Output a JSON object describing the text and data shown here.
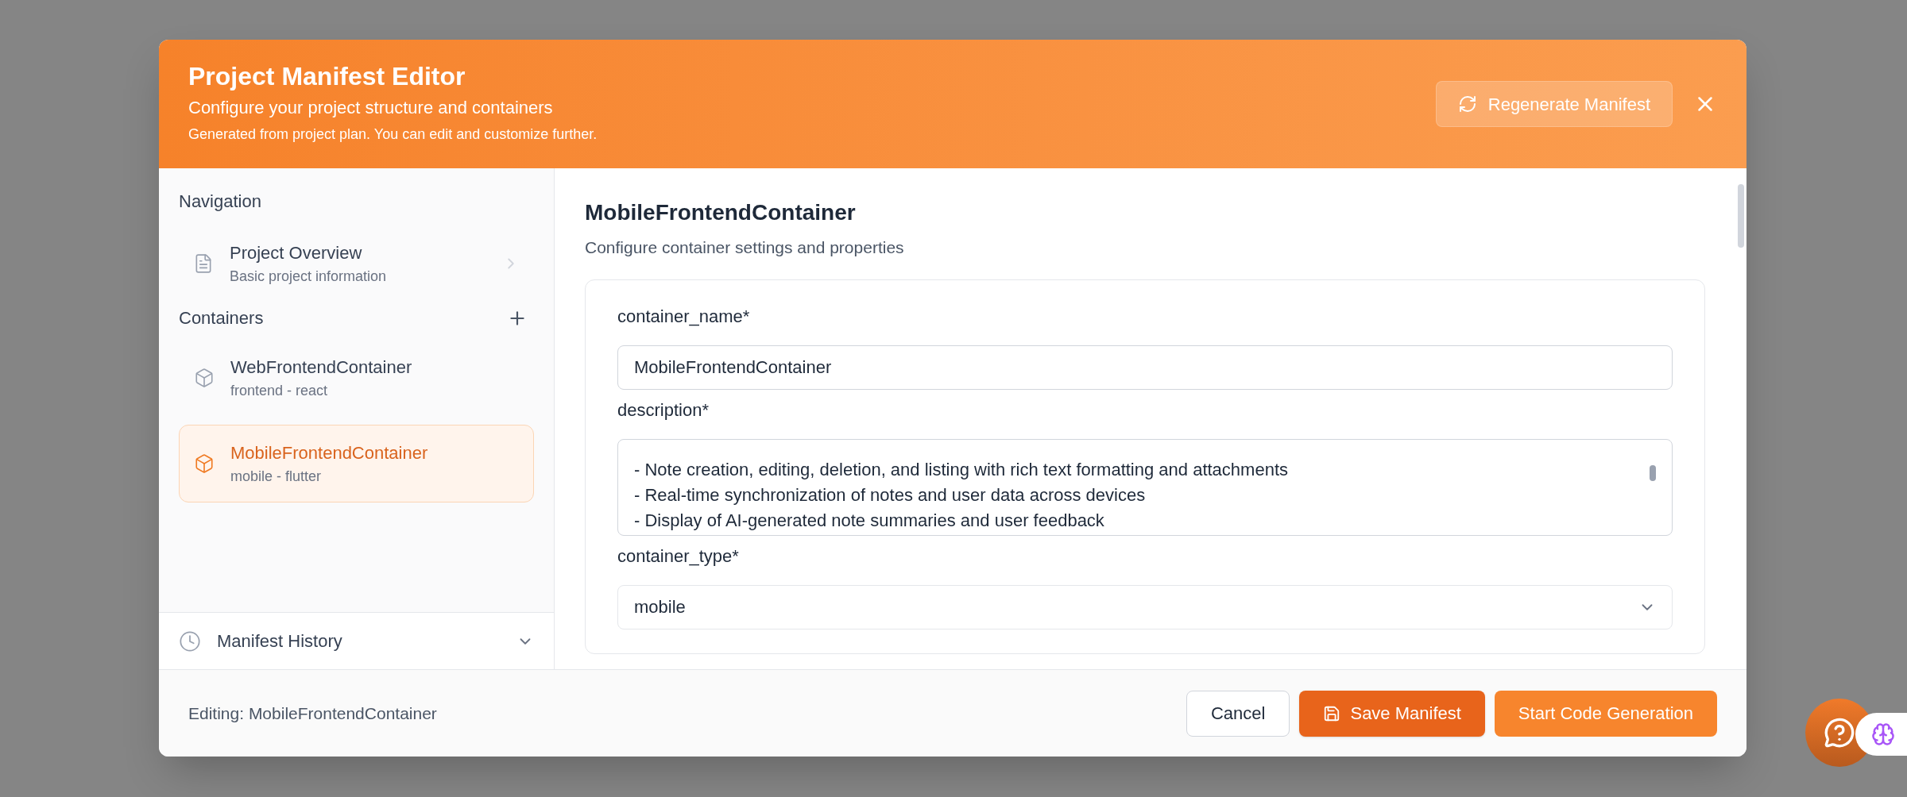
{
  "dialog": {
    "title": "Project Manifest Editor",
    "subtitle": "Configure your project structure and containers",
    "note": "Generated from project plan. You can edit and customize further.",
    "regenerate_button": "Regenerate Manifest"
  },
  "sidebar": {
    "navigation_heading": "Navigation",
    "overview": {
      "title": "Project Overview",
      "subtitle": "Basic project information"
    },
    "containers_heading": "Containers",
    "containers": [
      {
        "name": "WebFrontendContainer",
        "subtitle": "frontend - react",
        "selected": false
      },
      {
        "name": "MobileFrontendContainer",
        "subtitle": "mobile - flutter",
        "selected": true
      }
    ],
    "history": {
      "label": "Manifest History",
      "expanded": false
    }
  },
  "editor": {
    "title": "MobileFrontendContainer",
    "subtitle": "Configure container settings and properties",
    "fields": [
      {
        "kind": "input",
        "label": "container_name*",
        "value": "MobileFrontendContainer"
      },
      {
        "kind": "textarea",
        "label": "description*",
        "lines": [
          "- Note creation, editing, deletion, and listing with rich text formatting and attachments",
          "- Real-time synchronization of notes and user data across devices",
          "- Display of AI-generated note summaries and user feedback"
        ]
      },
      {
        "kind": "select",
        "label": "container_type*",
        "value": "mobile"
      }
    ]
  },
  "footer": {
    "status": "Editing: MobileFrontendContainer",
    "buttons": [
      {
        "label": "Cancel",
        "kind": "secondary"
      },
      {
        "label": "Save Manifest",
        "kind": "save"
      },
      {
        "label": "Start Code Generation",
        "kind": "primary"
      }
    ]
  }
}
